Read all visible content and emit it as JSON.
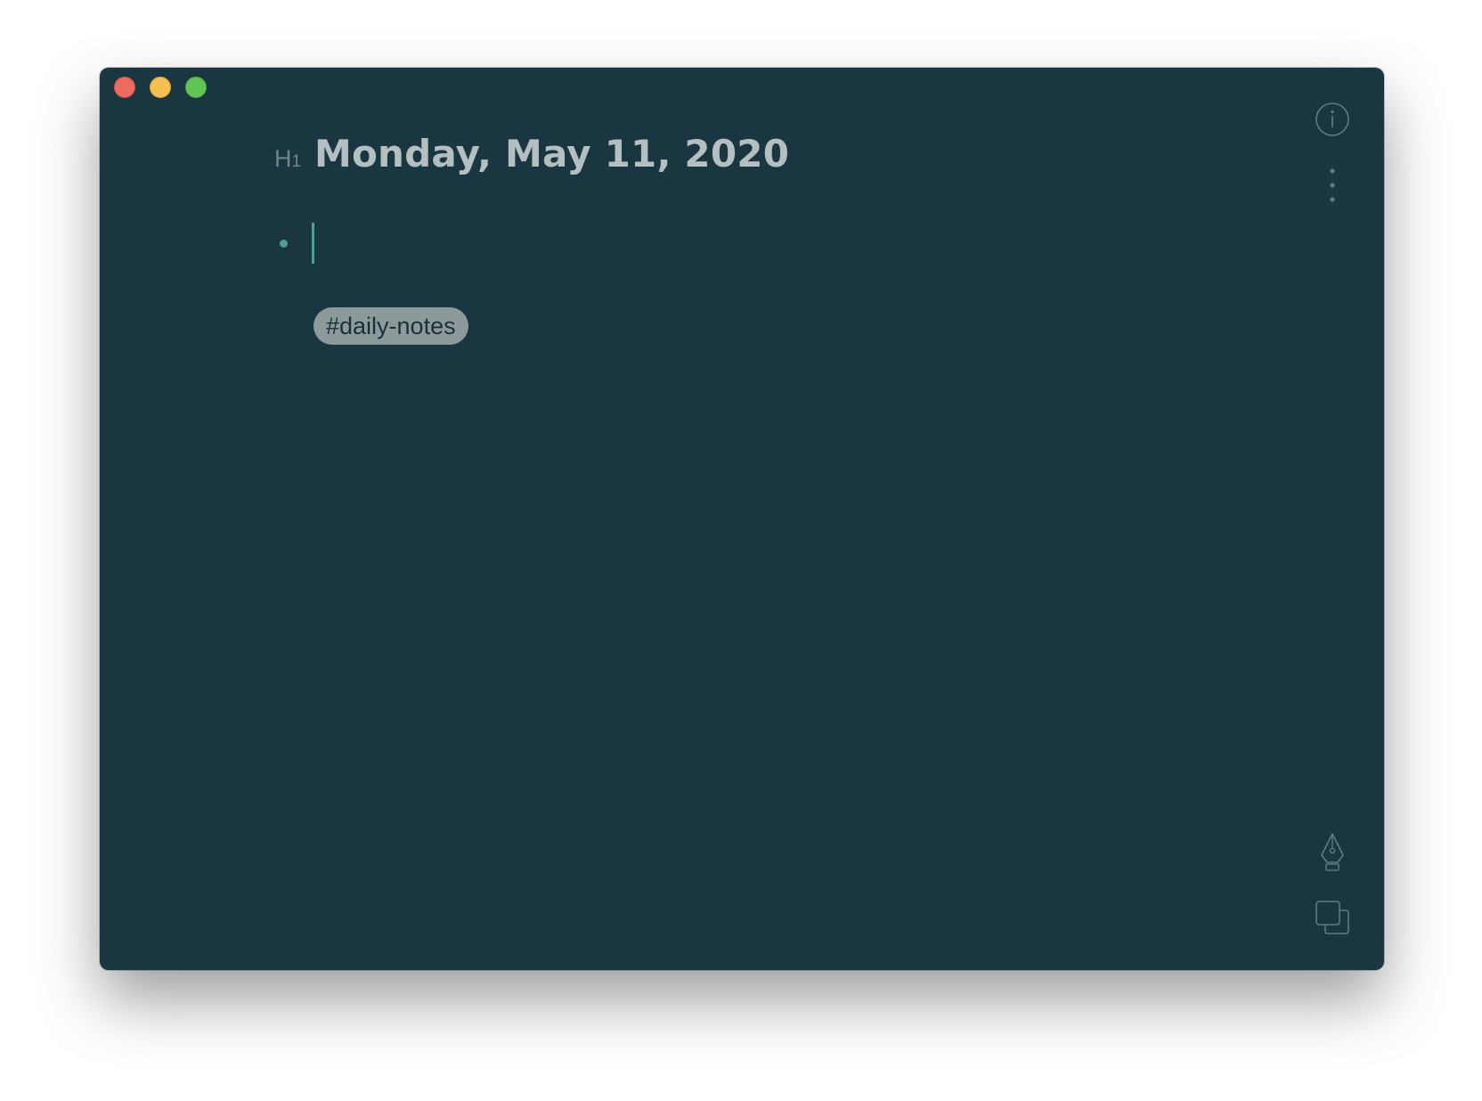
{
  "window": {
    "controls": [
      "close",
      "minimize",
      "zoom"
    ]
  },
  "note": {
    "heading_marker": "H",
    "heading_marker_level": "1",
    "title": "Monday, May 11, 2020",
    "bullet_text": "",
    "tag": "#daily-notes"
  },
  "sidebar_icons": [
    "info-icon",
    "more-vertical-icon",
    "pen-icon",
    "copy-icon"
  ],
  "colors": {
    "background": "#1a3641",
    "title": "#b4bfc2",
    "accent": "#4f9d96",
    "tag_bg": "#8d9a9c",
    "icon": "#5f7a82"
  }
}
